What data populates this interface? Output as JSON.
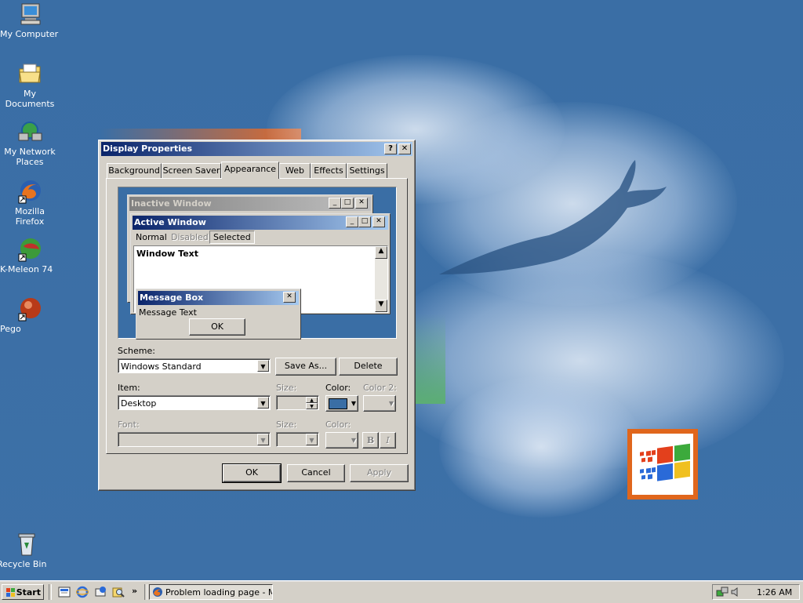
{
  "desktop": {
    "icons": [
      {
        "label": "My Computer"
      },
      {
        "label": "My Documents"
      },
      {
        "label": "My Network Places"
      },
      {
        "label": "Mozilla Firefox"
      },
      {
        "label": "K-Meleon 74"
      },
      {
        "label": "Pego"
      },
      {
        "label": "Recycle Bin"
      }
    ]
  },
  "dialog": {
    "title": "Display Properties",
    "help_btn": "?",
    "close_btn": "✕",
    "tabs": [
      "Background",
      "Screen Saver",
      "Appearance",
      "Web",
      "Effects",
      "Settings"
    ],
    "active_tab": "Appearance",
    "preview": {
      "inactive_title": "Inactive Window",
      "active_title": "Active Window",
      "menu": {
        "normal": "Normal",
        "disabled": "Disabled",
        "selected": "Selected"
      },
      "window_text": "Window Text",
      "message_box_title": "Message Box",
      "message_text": "Message Text",
      "ok": "OK"
    },
    "scheme": {
      "label": "Scheme:",
      "value": "Windows Standard",
      "save_as": "Save As...",
      "delete": "Delete"
    },
    "item": {
      "label": "Item:",
      "value": "Desktop",
      "size_label": "Size:",
      "color_label": "Color:",
      "color2_label": "Color 2:",
      "color": "#3a6ea5"
    },
    "font": {
      "label": "Font:",
      "size_label": "Size:",
      "color_label": "Color:",
      "bold": "B",
      "italic": "I"
    },
    "buttons": {
      "ok": "OK",
      "cancel": "Cancel",
      "apply": "Apply"
    }
  },
  "taskbar": {
    "start_label": "Start",
    "more_label": "»",
    "task": "Problem loading page - M...",
    "clock": "1:26 AM"
  },
  "colors": {
    "desktop": "#3a6ea5",
    "title_active": "#0a246a",
    "title_gradient": "#a6caf0",
    "face": "#d4d0c8"
  }
}
